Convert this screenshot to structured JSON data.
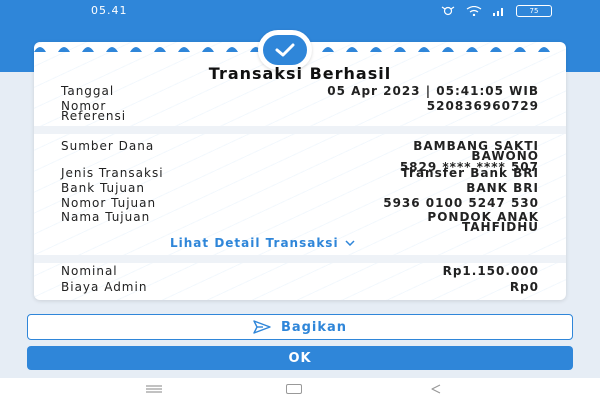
{
  "status_bar": {
    "time": "05.41",
    "battery": "75"
  },
  "receipt": {
    "title": "Transaksi Berhasil",
    "date_label": "Tanggal",
    "date_value": "05 Apr 2023 | 05:41:05 WIB",
    "ref_label_1": "Nomor",
    "ref_label_2": "Referensi",
    "ref_value": "520836960729",
    "source_label": "Sumber Dana",
    "source_name_1": "BAMBANG SAKTI",
    "source_name_2": "BAWONO",
    "source_account": "5829 **** **** 507",
    "type_label": "Jenis Transaksi",
    "type_value": "Transfer Bank BRI",
    "bank_label": "Bank Tujuan",
    "bank_value": "BANK BRI",
    "dest_no_label": "Nomor Tujuan",
    "dest_no_value": "5936 0100 5247 530",
    "dest_name_label": "Nama Tujuan",
    "dest_name_1": "PONDOK ANAK",
    "dest_name_2": "TAHFIDHU",
    "detail_link": "Lihat Detail Transaksi",
    "nominal_label": "Nominal",
    "nominal_value": "Rp1.150.000",
    "fee_label": "Biaya Admin",
    "fee_value": "Rp0"
  },
  "actions": {
    "share_label": "Bagikan",
    "ok_label": "OK"
  },
  "colors": {
    "accent": "#2f86d9"
  }
}
